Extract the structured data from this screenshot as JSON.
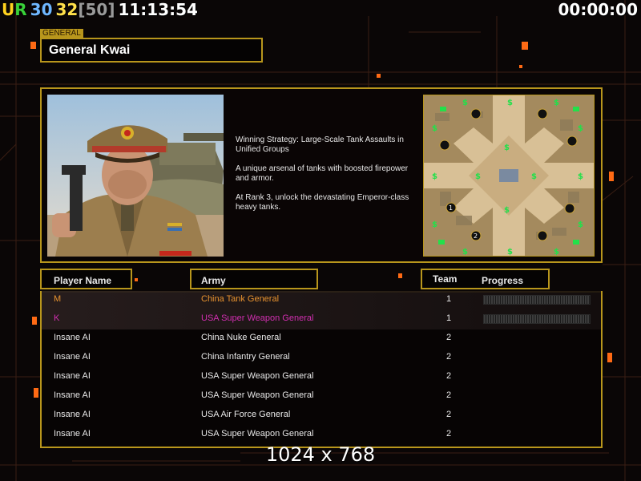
{
  "hud": {
    "ur": "UR",
    "stat1": "30",
    "stat2": "32",
    "stat3": "[50]",
    "clock": "11:13:54",
    "timer": "00:00:00"
  },
  "general": {
    "tag": "GENERAL",
    "name": "General Kwai",
    "description": [
      "Winning Strategy: Large-Scale Tank Assaults in\n Unified Groups",
      "A unique arsenal of tanks with boosted firepower\n and armor.",
      "At Rank 3, unlock the devastating Emperor-class\n heavy tanks."
    ]
  },
  "table": {
    "headers": {
      "player": "Player Name",
      "army": "Army",
      "team": "Team",
      "progress": "Progress"
    },
    "rows": [
      {
        "player": "M",
        "army": "China Tank General",
        "team": "1",
        "color": "#e8932f"
      },
      {
        "player": "K",
        "army": "USA Super Weapon General",
        "team": "1",
        "color": "#d12fb0"
      },
      {
        "player": "Insane AI",
        "army": "China Nuke General",
        "team": "2",
        "color": "#e8e8e8"
      },
      {
        "player": "Insane AI",
        "army": "China Infantry General",
        "team": "2",
        "color": "#e8e8e8"
      },
      {
        "player": "Insane AI",
        "army": "USA Super Weapon General",
        "team": "2",
        "color": "#e8e8e8"
      },
      {
        "player": "Insane AI",
        "army": "USA Super Weapon General",
        "team": "2",
        "color": "#e8e8e8"
      },
      {
        "player": "Insane AI",
        "army": "USA Air Force General",
        "team": "2",
        "color": "#e8e8e8"
      },
      {
        "player": "Insane AI",
        "army": "USA Super Weapon General",
        "team": "2",
        "color": "#e8e8e8"
      }
    ]
  },
  "resolution": "1024 x 768",
  "colors": {
    "gold": "#b8961c",
    "ur_yellow": "#ffd21f",
    "ur_green": "#39d239",
    "cyan": "#6fb7ff",
    "yellow": "#ffe04a",
    "gray": "#9a9a9a"
  },
  "icons": [
    "dollar-icon",
    "start-position-icon",
    "supply-crate-icon"
  ]
}
